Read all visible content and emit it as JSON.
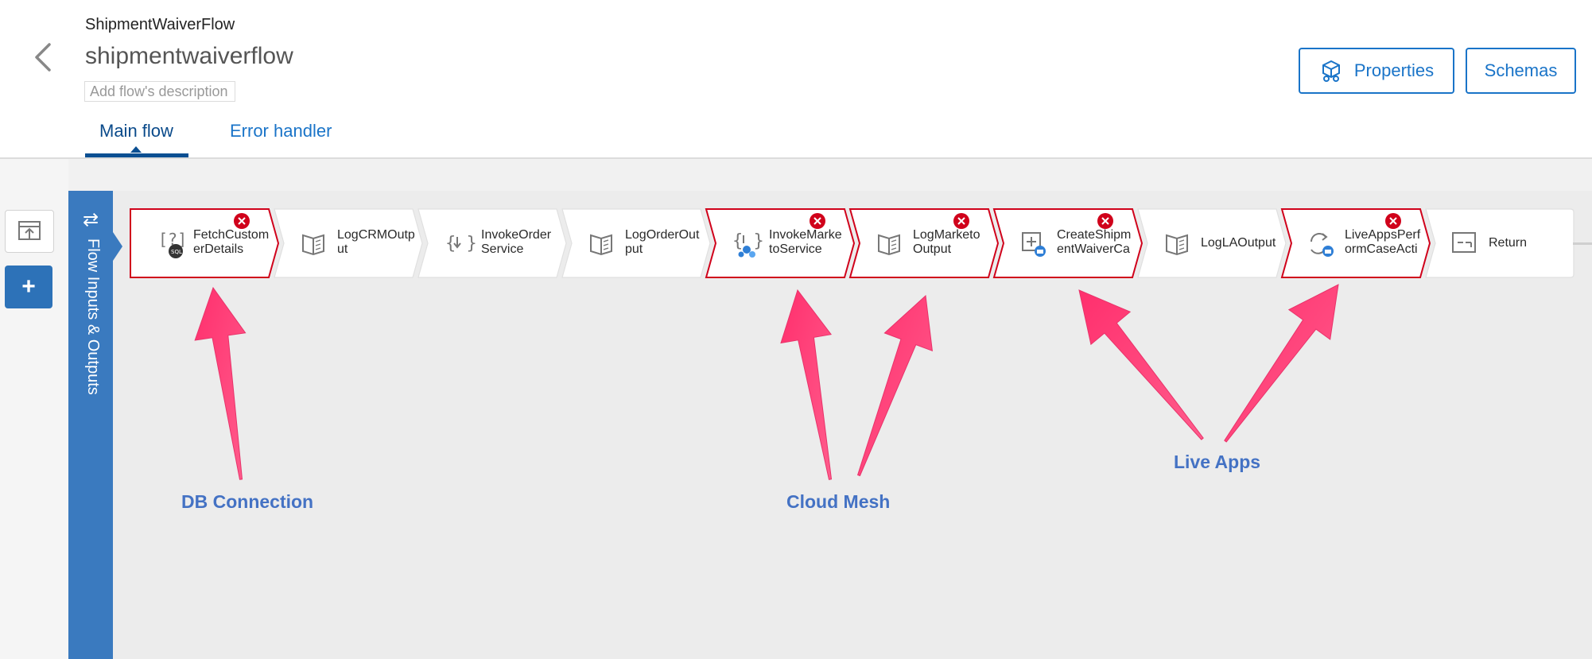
{
  "header": {
    "app_name": "ShipmentWaiverFlow",
    "flow_title": "shipmentwaiverflow",
    "description_placeholder": "Add flow's description",
    "properties_label": "Properties",
    "schemas_label": "Schemas"
  },
  "tabs": [
    {
      "label": "Main flow",
      "active": true
    },
    {
      "label": "Error handler",
      "active": false
    }
  ],
  "io_bar": {
    "label": "Flow Inputs & Outputs"
  },
  "steps": [
    {
      "line1": "FetchCustom",
      "line2": "erDetails",
      "icon": "sql-query-icon",
      "error": true
    },
    {
      "line1": "LogCRMOutp",
      "line2": "ut",
      "icon": "log-book-icon",
      "error": false
    },
    {
      "line1": "InvokeOrder",
      "line2": "Service",
      "icon": "invoke-service-icon",
      "error": false
    },
    {
      "line1": "LogOrderOut",
      "line2": "put",
      "icon": "log-book-icon",
      "error": false
    },
    {
      "line1": "InvokeMarke",
      "line2": "toService",
      "icon": "cloud-mesh-invoke-icon",
      "error": true
    },
    {
      "line1": "LogMarketo",
      "line2": "Output",
      "icon": "log-book-icon",
      "error": true
    },
    {
      "line1": "CreateShipm",
      "line2": "entWaiverCa",
      "icon": "create-case-icon",
      "error": true
    },
    {
      "line1": "LogLAOutput",
      "line2": "",
      "icon": "log-book-icon",
      "error": false
    },
    {
      "line1": "LiveAppsPerf",
      "line2": "ormCaseActi",
      "icon": "live-apps-action-icon",
      "error": true
    },
    {
      "line1": "Return",
      "line2": "",
      "icon": "return-icon",
      "error": false
    }
  ],
  "annotations": {
    "db_connection": "DB Connection",
    "cloud_mesh": "Cloud Mesh",
    "live_apps": "Live Apps"
  },
  "colors": {
    "accent": "#1a74c8",
    "io_bar": "#3a7abf",
    "error": "#d0021b",
    "arrow": "#ff3d79",
    "annotation": "#4472c4"
  }
}
